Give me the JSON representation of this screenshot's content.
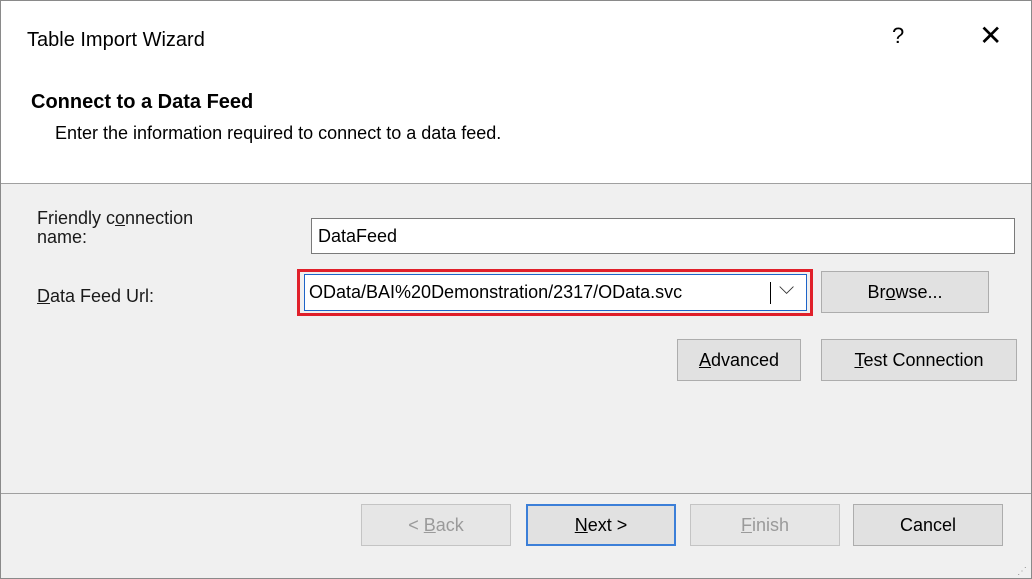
{
  "window": {
    "title": "Table Import Wizard",
    "help": "?",
    "close": "✕"
  },
  "header": {
    "title": "Connect to a Data Feed",
    "subtitle": "Enter the information required to connect to a data feed."
  },
  "form": {
    "friendly_name_label_a": "Friendly c",
    "friendly_name_label_u": "o",
    "friendly_name_label_b": "nnection",
    "friendly_name_label_c": "name:",
    "friendly_name_value": "DataFeed",
    "url_label_u": "D",
    "url_label_b": "ata Feed Url:",
    "url_value": "OData/BAI%20Demonstration/2317/OData.svc"
  },
  "buttons": {
    "browse_a": "Br",
    "browse_u": "o",
    "browse_b": "wse...",
    "advanced_u": "A",
    "advanced_b": "dvanced",
    "test_u": "T",
    "test_b": "est Connection",
    "back_a": "< ",
    "back_u": "B",
    "back_b": "ack",
    "next_u": "N",
    "next_b": "ext >",
    "finish_u": "F",
    "finish_b": "inish",
    "cancel": "Cancel"
  }
}
